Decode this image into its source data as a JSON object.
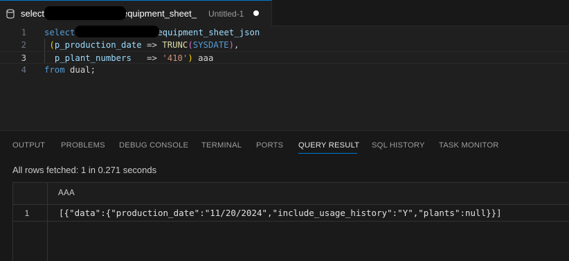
{
  "tab": {
    "title_start": "select",
    "title_end": "equipment_sheet_",
    "description": "Untitled-1",
    "icon": "database-icon"
  },
  "editor": {
    "lines": [
      {
        "number": "1",
        "code_kw": "select",
        "code_rest": "k.equipment_sheet_json"
      },
      {
        "number": "2",
        "paren": "(",
        "param": "p_production_date",
        "arrow": " => ",
        "fn": "TRUNC",
        "arg": "SYSDATE",
        "tail": ","
      },
      {
        "number": "3",
        "param": "p_plant_numbers",
        "spaces": "   ",
        "arrow": "=> ",
        "str": "'410'",
        "paren": ")",
        "alias": " aaa"
      },
      {
        "number": "4",
        "kw": "from",
        "rest": " dual;"
      }
    ]
  },
  "panel": {
    "tabs": [
      "OUTPUT",
      "PROBLEMS",
      "DEBUG CONSOLE",
      "TERMINAL",
      "PORTS",
      "QUERY RESULT",
      "SQL HISTORY",
      "TASK MONITOR"
    ],
    "active_tab": "QUERY RESULT"
  },
  "query_result": {
    "status": "All rows fetched: 1 in 0.271 seconds",
    "columns": [
      "AAA"
    ],
    "rows": [
      {
        "num": "1",
        "value": "[{\"data\":{\"production_date\":\"11/20/2024\",\"include_usage_history\":\"Y\",\"plants\":null}}]"
      }
    ]
  },
  "colors": {
    "accent": "#0078d4",
    "keyword": "#569cd6",
    "identifier": "#9cdcfe",
    "function": "#dcdcaa",
    "string": "#ce9178"
  }
}
